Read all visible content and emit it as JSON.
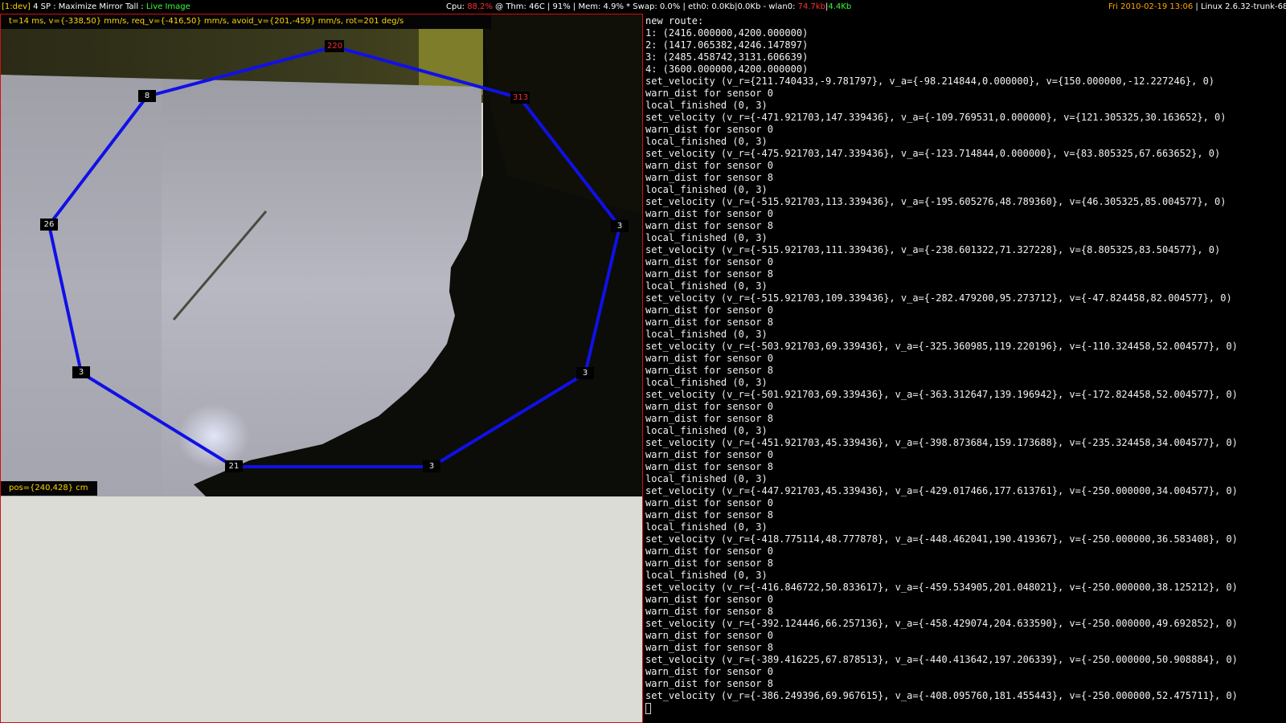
{
  "topbar": {
    "workspace": "[1:dev]",
    "layout": " 4 SP : Maximize Mirror Tall : ",
    "window_title": "Live Image",
    "cpu_label": "Cpu: ",
    "cpu_value": "88.2%",
    "sys_info": " @ Thm: 46C | 91% | Mem: 4.9% * Swap: 0.0% | eth0: 0.0Kb|0.0Kb - wlan0: ",
    "wlan_rx": "74.7kb",
    "wlan_sep": "|",
    "wlan_tx": "4.4Kb",
    "datetime": "Fri 2010-02-19 13:06",
    "kernel": " | Linux 2.6.32-trunk-686"
  },
  "camera": {
    "hud_top": "t=14 ms, v={-338,50} mm/s, req_v={-416,50} mm/s, avoid_v={201,-459} mm/s, rot=201 deg/s",
    "position": "pos={240,428} cm",
    "polygon_color": "#1010e8",
    "vertices": [
      {
        "label": "220",
        "alert": true
      },
      {
        "label": "313",
        "alert": true
      },
      {
        "label": "3",
        "alert": false
      },
      {
        "label": "3",
        "alert": false
      },
      {
        "label": "3",
        "alert": false
      },
      {
        "label": "21",
        "alert": false
      },
      {
        "label": "3",
        "alert": false
      },
      {
        "label": "26",
        "alert": false
      },
      {
        "label": "8",
        "alert": false
      }
    ]
  },
  "terminal": {
    "lines": [
      "new route:",
      "1: (2416.000000,4200.000000)",
      "2: (1417.065382,4246.147897)",
      "3: (2485.458742,3131.606639)",
      "4: (3600.000000,4200.000000)",
      "set_velocity (v_r={211.740433,-9.781797}, v_a={-98.214844,0.000000}, v={150.000000,-12.227246}, 0)",
      "warn_dist for sensor 0",
      "local_finished (0, 3)",
      "set_velocity (v_r={-471.921703,147.339436}, v_a={-109.769531,0.000000}, v={121.305325,30.163652}, 0)",
      "warn_dist for sensor 0",
      "local_finished (0, 3)",
      "set_velocity (v_r={-475.921703,147.339436}, v_a={-123.714844,0.000000}, v={83.805325,67.663652}, 0)",
      "warn_dist for sensor 0",
      "warn_dist for sensor 8",
      "local_finished (0, 3)",
      "set_velocity (v_r={-515.921703,113.339436}, v_a={-195.605276,48.789360}, v={46.305325,85.004577}, 0)",
      "warn_dist for sensor 0",
      "warn_dist for sensor 8",
      "local_finished (0, 3)",
      "set_velocity (v_r={-515.921703,111.339436}, v_a={-238.601322,71.327228}, v={8.805325,83.504577}, 0)",
      "warn_dist for sensor 0",
      "warn_dist for sensor 8",
      "local_finished (0, 3)",
      "set_velocity (v_r={-515.921703,109.339436}, v_a={-282.479200,95.273712}, v={-47.824458,82.004577}, 0)",
      "warn_dist for sensor 0",
      "warn_dist for sensor 8",
      "local_finished (0, 3)",
      "set_velocity (v_r={-503.921703,69.339436}, v_a={-325.360985,119.220196}, v={-110.324458,52.004577}, 0)",
      "warn_dist for sensor 0",
      "warn_dist for sensor 8",
      "local_finished (0, 3)",
      "set_velocity (v_r={-501.921703,69.339436}, v_a={-363.312647,139.196942}, v={-172.824458,52.004577}, 0)",
      "warn_dist for sensor 0",
      "warn_dist for sensor 8",
      "local_finished (0, 3)",
      "set_velocity (v_r={-451.921703,45.339436}, v_a={-398.873684,159.173688}, v={-235.324458,34.004577}, 0)",
      "warn_dist for sensor 0",
      "warn_dist for sensor 8",
      "local_finished (0, 3)",
      "set_velocity (v_r={-447.921703,45.339436}, v_a={-429.017466,177.613761}, v={-250.000000,34.004577}, 0)",
      "warn_dist for sensor 0",
      "warn_dist for sensor 8",
      "local_finished (0, 3)",
      "set_velocity (v_r={-418.775114,48.777878}, v_a={-448.462041,190.419367}, v={-250.000000,36.583408}, 0)",
      "warn_dist for sensor 0",
      "warn_dist for sensor 8",
      "local_finished (0, 3)",
      "set_velocity (v_r={-416.846722,50.833617}, v_a={-459.534905,201.048021}, v={-250.000000,38.125212}, 0)",
      "warn_dist for sensor 0",
      "warn_dist for sensor 8",
      "set_velocity (v_r={-392.124446,66.257136}, v_a={-458.429074,204.633590}, v={-250.000000,49.692852}, 0)",
      "warn_dist for sensor 0",
      "warn_dist for sensor 8",
      "set_velocity (v_r={-389.416225,67.878513}, v_a={-440.413642,197.206339}, v={-250.000000,50.908884}, 0)",
      "warn_dist for sensor 0",
      "warn_dist for sensor 8",
      "set_velocity (v_r={-386.249396,69.967615}, v_a={-408.095760,181.455443}, v={-250.000000,52.475711}, 0)"
    ]
  }
}
